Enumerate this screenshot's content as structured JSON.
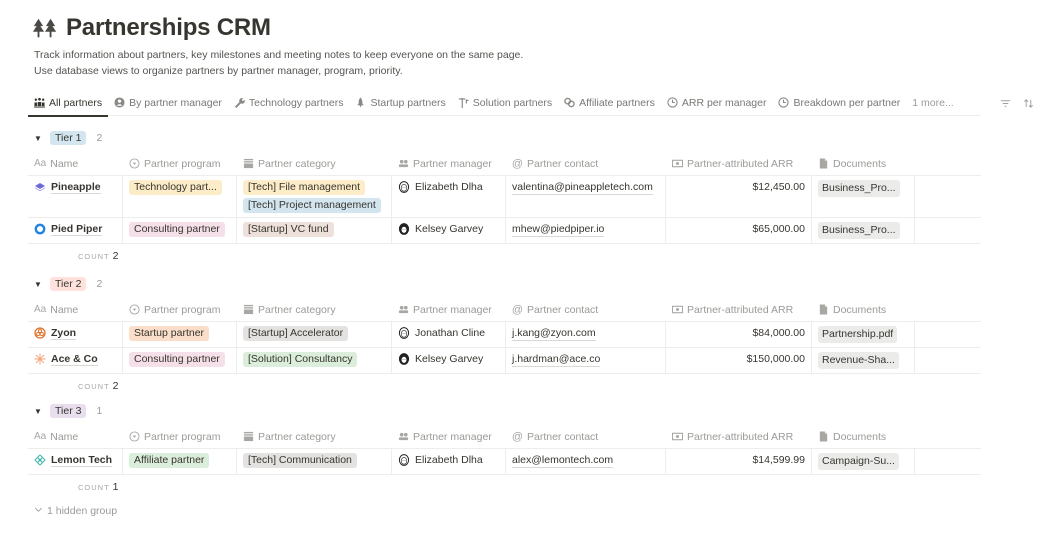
{
  "page": {
    "title": "Partnerships CRM",
    "description_lines": [
      "Track information about partners, key milestones and meeting notes to keep everyone on the same page.",
      "Use database views to organize partners by partner manager, program, priority."
    ]
  },
  "tabs": [
    {
      "label": "All partners",
      "icon": "people-icon",
      "active": true
    },
    {
      "label": "By partner manager",
      "icon": "person-circle-icon"
    },
    {
      "label": "Technology partners",
      "icon": "wrench-icon"
    },
    {
      "label": "Startup partners",
      "icon": "rocket-icon"
    },
    {
      "label": "Solution partners",
      "icon": "signpost-icon"
    },
    {
      "label": "Affiliate partners",
      "icon": "link-icon"
    },
    {
      "label": "ARR per manager",
      "icon": "chart-clock-icon"
    },
    {
      "label": "Breakdown per partner",
      "icon": "chart-clock-icon"
    }
  ],
  "tabs_more": "1 more...",
  "columns": {
    "name": "Name",
    "program": "Partner program",
    "category": "Partner category",
    "manager": "Partner manager",
    "contact": "Partner contact",
    "arr": "Partner-attributed ARR",
    "documents": "Documents"
  },
  "colors": {
    "tier1": "#d3e5ef",
    "tier2": "#ffe2dd",
    "tier3": "#e8deee",
    "orange": "#fadec9",
    "yellow": "#fdecc8",
    "blue": "#d3e5ef",
    "pink": "#f5e0e9",
    "brown": "#eee0da",
    "gray": "#e3e2e0",
    "green": "#dbeddb"
  },
  "groups": [
    {
      "label": "Tier 1",
      "count": "2",
      "count_label": "COUNT",
      "footer_count": "2",
      "rows": [
        {
          "name": "Pineapple",
          "icon": "layers-icon",
          "program": "Technology part...",
          "program_color": "yellow",
          "categories": [
            {
              "label": "[Tech] File management",
              "color": "yellow"
            },
            {
              "label": "[Tech] Project management",
              "color": "blue"
            }
          ],
          "manager": "Elizabeth Dlha",
          "contact": "valentina@pineappletech.com",
          "arr": "$12,450.00",
          "document": "Business_Pro..."
        },
        {
          "name": "Pied Piper",
          "icon": "ring-icon",
          "program": "Consulting partner",
          "program_color": "pink",
          "categories": [
            {
              "label": "[Startup] VC fund",
              "color": "brown"
            }
          ],
          "manager": "Kelsey Garvey",
          "contact": "mhew@piedpiper.io",
          "arr": "$65,000.00",
          "document": "Business_Pro..."
        }
      ]
    },
    {
      "label": "Tier 2",
      "count": "2",
      "count_label": "COUNT",
      "footer_count": "2",
      "rows": [
        {
          "name": "Zyon",
          "icon": "flower-icon",
          "program": "Startup partner",
          "program_color": "orange",
          "categories": [
            {
              "label": "[Startup] Accelerator",
              "color": "gray"
            }
          ],
          "manager": "Jonathan Cline",
          "contact": "j.kang@zyon.com",
          "arr": "$84,000.00",
          "document": "Partnership.pdf"
        },
        {
          "name": "Ace & Co",
          "icon": "sparkle-icon",
          "program": "Consulting partner",
          "program_color": "pink",
          "categories": [
            {
              "label": "[Solution] Consultancy",
              "color": "green"
            }
          ],
          "manager": "Kelsey Garvey",
          "contact": "j.hardman@ace.co",
          "arr": "$150,000.00",
          "document": "Revenue-Sha..."
        }
      ]
    },
    {
      "label": "Tier 3",
      "count": "1",
      "count_label": "COUNT",
      "footer_count": "1",
      "rows": [
        {
          "name": "Lemon Tech",
          "icon": "lattice-icon",
          "program": "Affiliate partner",
          "program_color": "green",
          "categories": [
            {
              "label": "[Tech] Communication",
              "color": "gray"
            }
          ],
          "manager": "Elizabeth Dlha",
          "contact": "alex@lemontech.com",
          "arr": "$14,599.99",
          "document": "Campaign-Su..."
        }
      ]
    }
  ],
  "hidden_groups": "1 hidden group"
}
